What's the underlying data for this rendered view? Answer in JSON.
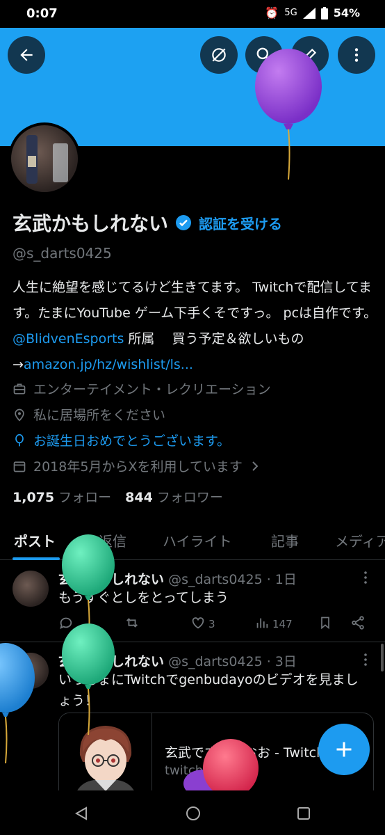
{
  "status_bar": {
    "time": "0:07",
    "battery": "54%",
    "network": "5G"
  },
  "header": {
    "back_icon": "arrow-left-icon",
    "buttons": [
      "block-icon",
      "search-icon",
      "edit-icon",
      "more-vertical-icon"
    ]
  },
  "profile": {
    "name": "玄武かもしれない",
    "verify_cta": "認証を受ける",
    "handle": "@s_darts0425",
    "bio_parts": [
      "人生に絶望を感じてるけど生きてます。 Twitchで配信してます。たまにYouTube ゲーム下手くそですっ。 pcは自作です。 ",
      "@BlidvenEsports",
      " 所属 　買う予定＆欲しいもの→",
      "amazon.jp/hz/wishlist/ls..."
    ],
    "category": "エンターテイメント・レクリエーション",
    "location": "私に居場所をください",
    "birthday": "お誕生日おめでとうございます。",
    "joined": "2018年5月からXを利用しています",
    "following_count": "1,075",
    "following_label": "フォロー",
    "followers_count": "844",
    "followers_label": "フォロワー"
  },
  "tabs": [
    {
      "label": "ポスト"
    },
    {
      "label": "返信"
    },
    {
      "label": "ハイライト"
    },
    {
      "label": "記事"
    },
    {
      "label": "メディア"
    }
  ],
  "posts": [
    {
      "name": "玄武かもしれない",
      "meta": "@s_darts0425 · 1日",
      "text": "もうすぐとしをとってしまう",
      "likes": "3",
      "views": "147"
    },
    {
      "name": "玄武かもしれない",
      "meta": "@s_darts0425 · 3日",
      "text": "いっしょにTwitchでgenbudayoのビデオを見ましょう！",
      "card_title": "玄武ですよおおお - Twitch",
      "card_domain": "twitch.tv"
    }
  ],
  "colors": {
    "accent": "#1d9bf0",
    "banner": "#1da1f2",
    "background": "#000000"
  }
}
